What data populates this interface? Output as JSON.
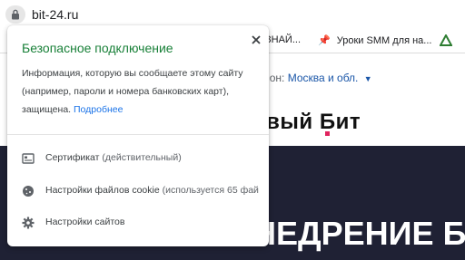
{
  "address_bar": {
    "url": "bit-24.ru"
  },
  "bookmarks": [
    {
      "icon": "pin-icon",
      "label": "ЗНАЙ..."
    },
    {
      "icon": "pin-icon",
      "label": "Уроки SMM для на..."
    },
    {
      "icon": "triangle-logo-icon",
      "label": ""
    }
  ],
  "site": {
    "region_label": "ион:",
    "region_value": "Москва и обл.",
    "logo_text": "овый Бит",
    "hero_title": "ВНЕДРЕНИЕ БИТ"
  },
  "popup": {
    "title": "Безопасное подключение",
    "description": "Информация, которую вы сообщаете этому сайту (например, пароли и номера банковских карт), защищена.",
    "learn_more": "Подробнее",
    "menu": [
      {
        "label": "Сертификат",
        "sub": "(действительный)"
      },
      {
        "label": "Настройки файлов cookie",
        "sub": "(используется 65 фай"
      },
      {
        "label": "Настройки сайтов",
        "sub": ""
      }
    ]
  },
  "colors": {
    "secure_green": "#188038",
    "link_blue": "#1a73e8",
    "hero_bg": "#1f2134"
  }
}
